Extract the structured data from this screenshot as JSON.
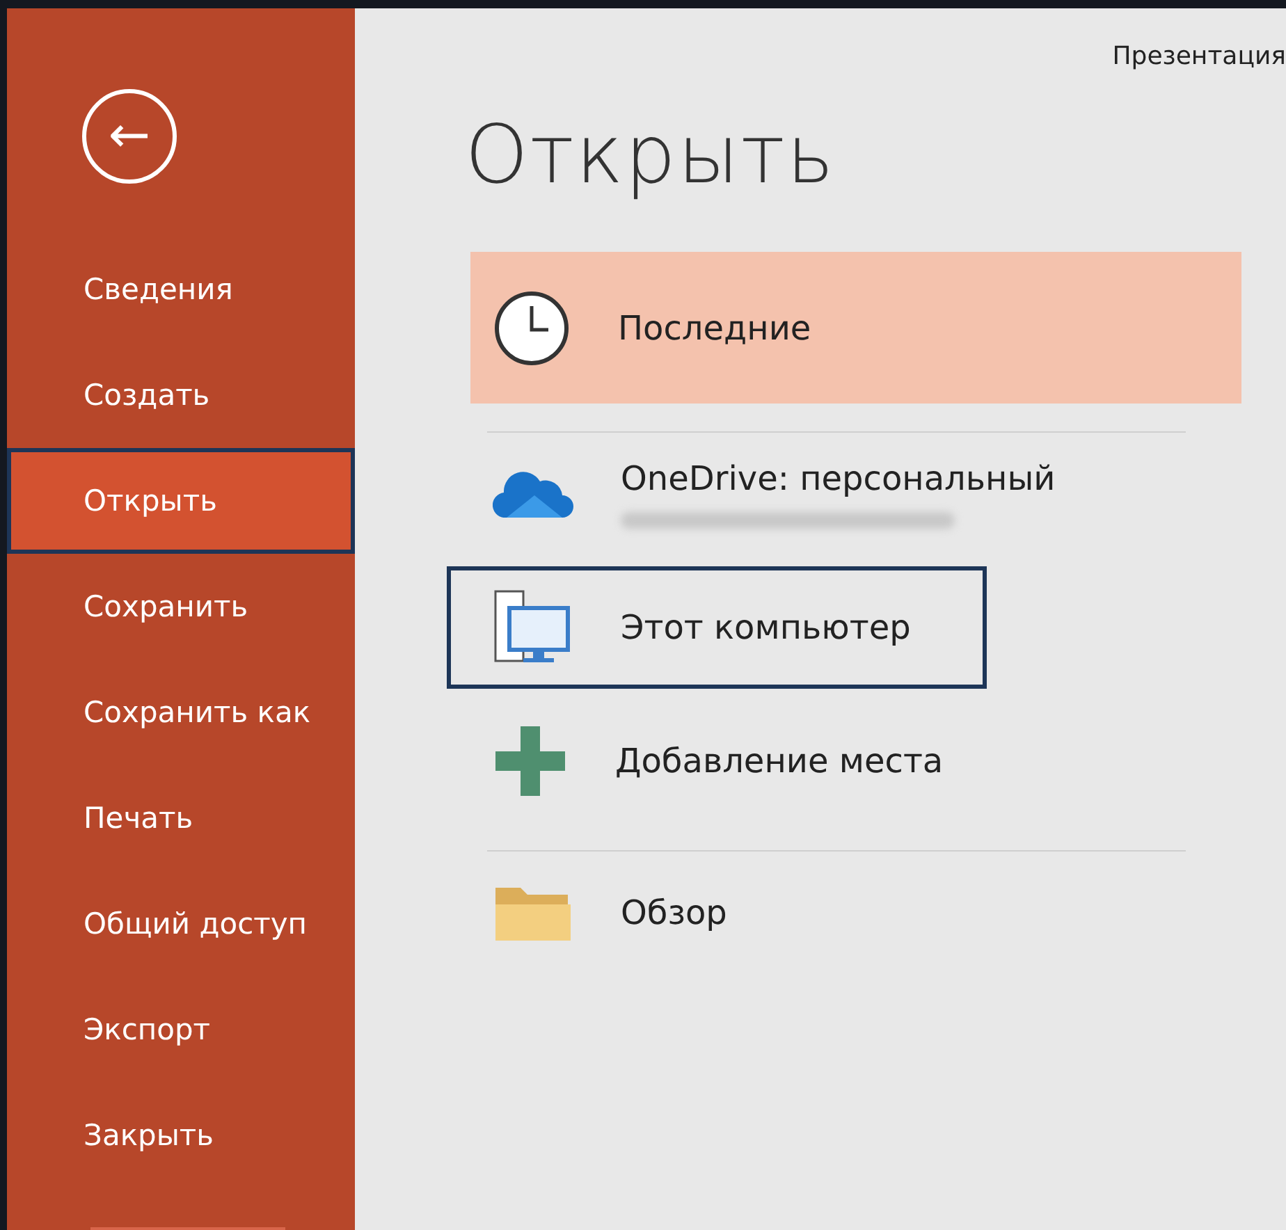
{
  "window": {
    "title": "Презентация"
  },
  "back_button": {
    "label": "←"
  },
  "sidebar": {
    "items": [
      {
        "label": "Сведения",
        "selected": false,
        "focused": false
      },
      {
        "label": "Создать",
        "selected": false,
        "focused": false
      },
      {
        "label": "Открыть",
        "selected": true,
        "focused": true
      },
      {
        "label": "Сохранить",
        "selected": false,
        "focused": false
      },
      {
        "label": "Сохранить как",
        "selected": false,
        "focused": false
      },
      {
        "label": "Печать",
        "selected": false,
        "focused": false
      },
      {
        "label": "Общий доступ",
        "selected": false,
        "focused": false
      },
      {
        "label": "Экспорт",
        "selected": false,
        "focused": false
      },
      {
        "label": "Закрыть",
        "selected": false,
        "focused": false
      }
    ]
  },
  "heading": "Открыть",
  "locations": [
    {
      "kind": "clock",
      "label": "Последние",
      "selected": true,
      "focused": false,
      "blurred_subtitle": false,
      "divider_after": true
    },
    {
      "kind": "cloud",
      "label": "OneDrive: персональный",
      "selected": false,
      "focused": false,
      "blurred_subtitle": true,
      "divider_after": false
    },
    {
      "kind": "computer",
      "label": "Этот компьютер",
      "selected": false,
      "focused": true,
      "blurred_subtitle": false,
      "divider_after": false
    },
    {
      "kind": "plus",
      "label": "Добавление места",
      "selected": false,
      "focused": false,
      "blurred_subtitle": false,
      "divider_after": true
    },
    {
      "kind": "folder",
      "label": "Обзор",
      "selected": false,
      "focused": false,
      "blurred_subtitle": false,
      "divider_after": false
    }
  ]
}
